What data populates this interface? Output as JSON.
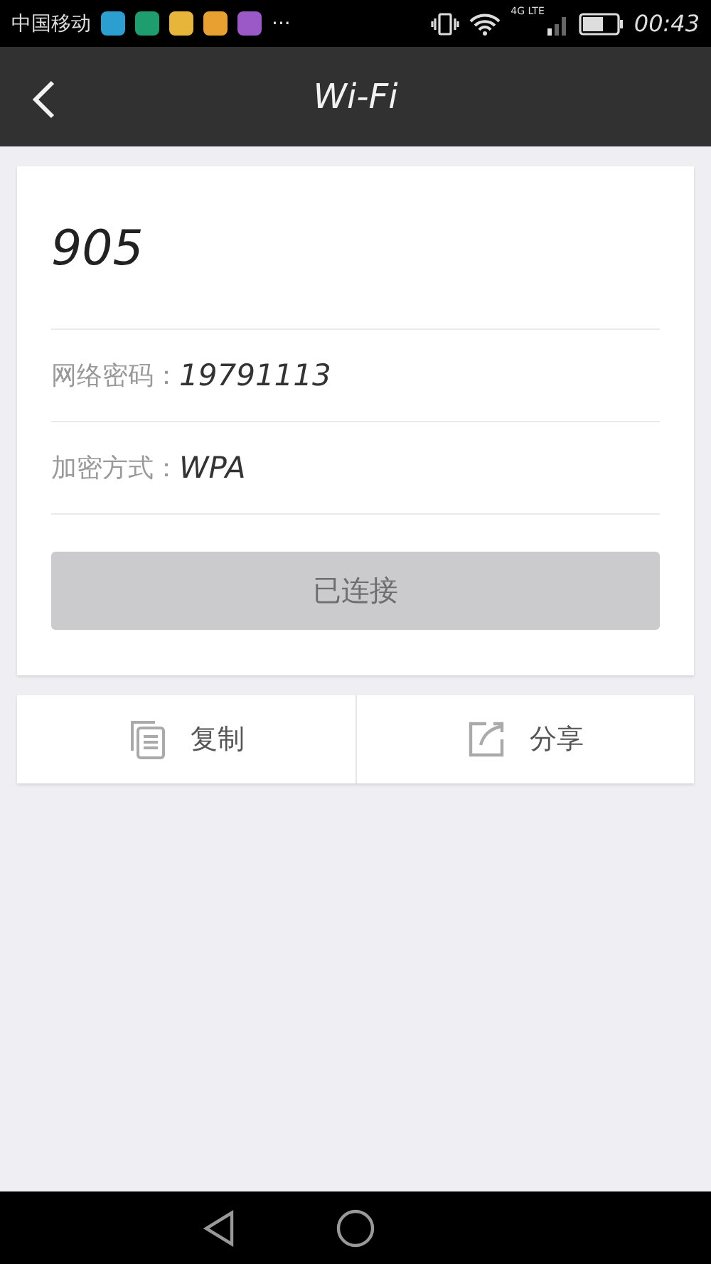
{
  "status_bar": {
    "carrier": "中国移动",
    "app_icons": [
      {
        "color": "#2a9fd0"
      },
      {
        "color": "#1e9e6e"
      },
      {
        "color": "#e6b53a"
      },
      {
        "color": "#e8a030"
      },
      {
        "color": "#9b59c8"
      }
    ],
    "more": "···",
    "network_label": "4G LTE",
    "time": "00:43"
  },
  "header": {
    "title": "Wi-Fi"
  },
  "network": {
    "name": "905",
    "fields": [
      {
        "label": "网络密码：",
        "value": "19791113"
      },
      {
        "label": "加密方式：",
        "value": "WPA"
      }
    ],
    "button": {
      "label": "已连接",
      "disabled": true
    }
  },
  "actions": [
    {
      "kind": "copy",
      "label": "复制"
    },
    {
      "kind": "share",
      "label": "分享"
    }
  ]
}
